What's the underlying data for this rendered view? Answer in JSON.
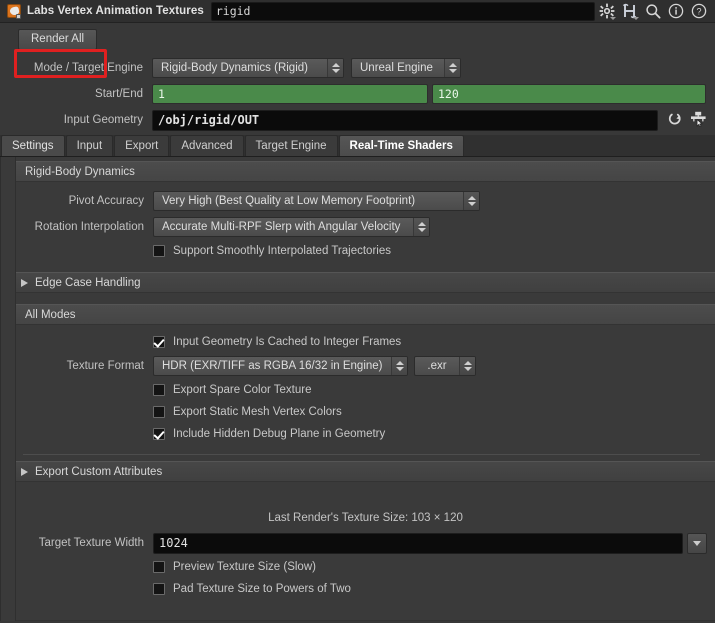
{
  "titlebar": {
    "app_title": "Labs Vertex Animation Textures",
    "node_name_value": "rigid",
    "node_name_placeholder": "",
    "icons": [
      {
        "name": "gear-icon",
        "label": "Parameter Menu"
      },
      {
        "name": "houdini-h-icon",
        "label": "H"
      },
      {
        "name": "search-icon",
        "label": "Search"
      },
      {
        "name": "info-icon",
        "label": "Info"
      },
      {
        "name": "help-icon",
        "label": "Help"
      }
    ]
  },
  "toolbar": {
    "render_all_label": "Render All",
    "highlight_color": "#e02020"
  },
  "params": {
    "mode_target_engine": {
      "label": "Mode / Target Engine",
      "mode_value": "Rigid-Body Dynamics (Rigid)",
      "engine_value": "Unreal Engine"
    },
    "start_end": {
      "label": "Start/End",
      "start_value": "1",
      "end_value": "120",
      "field_color": "#4a8a4a"
    },
    "input_geometry": {
      "label": "Input Geometry",
      "value": "/obj/rigid/OUT",
      "reload_icon": "reload-icon",
      "picker_icon": "node-picker-icon"
    }
  },
  "tabs": [
    {
      "label": "Settings",
      "state": "semi"
    },
    {
      "label": "Input",
      "state": "normal"
    },
    {
      "label": "Export",
      "state": "normal"
    },
    {
      "label": "Advanced",
      "state": "normal"
    },
    {
      "label": "Target Engine",
      "state": "normal"
    },
    {
      "label": "Real-Time Shaders",
      "state": "active"
    }
  ],
  "sections": {
    "rigid_body_dynamics": {
      "title": "Rigid-Body Dynamics",
      "pivot_accuracy": {
        "label": "Pivot Accuracy",
        "value": "Very High (Best Quality at Low Memory Footprint)"
      },
      "rotation_interpolation": {
        "label": "Rotation Interpolation",
        "value": "Accurate Multi-RPF Slerp with Angular Velocity"
      },
      "support_smooth": {
        "label": "Support Smoothly Interpolated Trajectories",
        "checked": false
      }
    },
    "edge_case_handling": {
      "title": "Edge Case Handling",
      "collapsed": true
    },
    "all_modes": {
      "title": "All Modes",
      "input_cached": {
        "label": "Input Geometry Is Cached to Integer Frames",
        "checked": true
      },
      "texture_format": {
        "label": "Texture Format",
        "value": "HDR (EXR/TIFF as RGBA 16/32 in Engine)",
        "extension_value": ".exr"
      },
      "export_spare": {
        "label": "Export Spare Color Texture",
        "checked": false
      },
      "export_static_mesh": {
        "label": "Export Static Mesh Vertex Colors",
        "checked": false
      },
      "include_debug_plane": {
        "label": "Include Hidden Debug Plane in Geometry",
        "checked": true
      }
    },
    "export_custom_attributes": {
      "title": "Export Custom Attributes",
      "collapsed": true
    },
    "texture_size": {
      "last_render_note": "Last Render's Texture Size: 103 × 120",
      "target_texture_width": {
        "label": "Target Texture Width",
        "value": "1024"
      },
      "preview_texture_size": {
        "label": "Preview Texture Size (Slow)",
        "checked": false
      },
      "pad_powers_of_two": {
        "label": "Pad Texture Size to Powers of Two",
        "checked": false
      }
    }
  }
}
